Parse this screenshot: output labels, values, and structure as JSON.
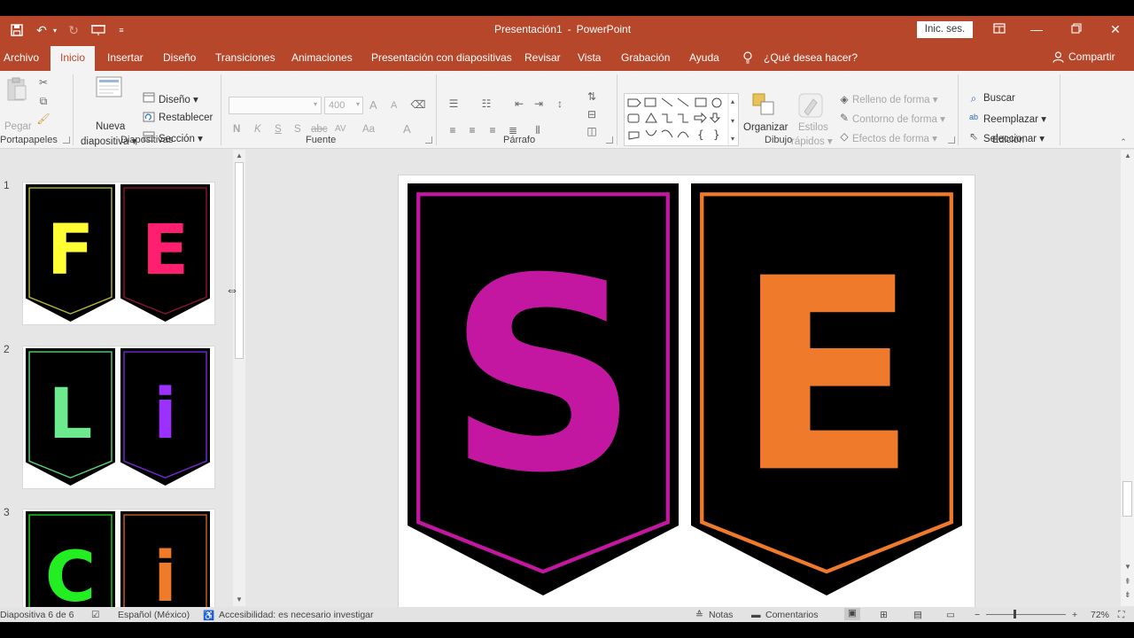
{
  "titlebar": {
    "doc_name": "Presentación1",
    "separator": "-",
    "app_name": "PowerPoint",
    "signin_label": "Inic. ses."
  },
  "tabs": [
    "Archivo",
    "Inicio",
    "Insertar",
    "Diseño",
    "Transiciones",
    "Animaciones",
    "Presentación con diapositivas",
    "Revisar",
    "Vista",
    "Grabación",
    "Ayuda"
  ],
  "tell_me": "¿Qué desea hacer?",
  "share_label": "Compartir",
  "ribbon": {
    "clipboard": {
      "paste": "Pegar",
      "group": "Portapapeles"
    },
    "slides": {
      "new_slide_1": "Nueva",
      "new_slide_2": "diapositiva",
      "layout": "Diseño",
      "reset": "Restablecer",
      "section": "Sección",
      "group": "Diapositivas"
    },
    "font": {
      "font_size": "400",
      "bold": "N",
      "italic": "K",
      "underline": "S",
      "shadow": "S",
      "strike": "abc",
      "spacing": "AV",
      "case": "Aa",
      "color": "A",
      "grow": "A",
      "shrink": "A",
      "group": "Fuente"
    },
    "paragraph": {
      "group": "Párrafo"
    },
    "drawing": {
      "arrange": "Organizar",
      "quick_styles_1": "Estilos",
      "quick_styles_2": "rápidos",
      "shape_fill": "Relleno de forma",
      "shape_outline": "Contorno de forma",
      "shape_effects": "Efectos de forma",
      "group": "Dibujo"
    },
    "editing": {
      "find": "Buscar",
      "replace": "Reemplazar",
      "select": "Seleccionar",
      "group": "Edición"
    }
  },
  "slides": [
    {
      "number": "1",
      "banners": [
        {
          "letter": "F",
          "color": "#ffff33",
          "border": "#b5b83a"
        },
        {
          "letter": "E",
          "color": "#ff1f6e",
          "border": "#8a1235"
        }
      ]
    },
    {
      "number": "2",
      "banners": [
        {
          "letter": "L",
          "color": "#6eea8e",
          "border": "#5bd47a"
        },
        {
          "letter": "i",
          "color": "#9b30ff",
          "border": "#7a27d6"
        }
      ]
    },
    {
      "number": "3",
      "banners": [
        {
          "letter": "C",
          "color": "#22ee22",
          "border": "#1dd41d"
        },
        {
          "letter": "i",
          "color": "#ef7a2a",
          "border": "#c86020"
        }
      ]
    }
  ],
  "current_slide": {
    "banners": [
      {
        "letter": "S",
        "color": "#c417a1",
        "border": "#c417a1"
      },
      {
        "letter": "E",
        "color": "#f07a2c",
        "border": "#f07a2c"
      }
    ]
  },
  "status": {
    "slide_indicator": "Diapositiva 6 de 6",
    "language": "Español (México)",
    "accessibility": "Accesibilidad: es necesario investigar",
    "notes": "Notas",
    "comments": "Comentarios",
    "zoom": "72%"
  }
}
